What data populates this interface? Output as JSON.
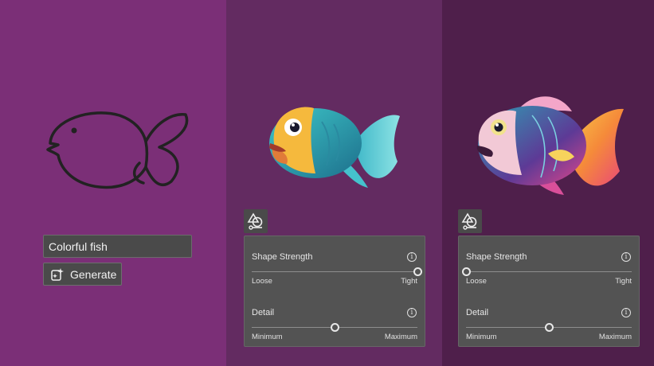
{
  "panels": [
    {
      "name": "sketch",
      "bg": "#7b2f77"
    },
    {
      "name": "result-detailed",
      "bg": "#632b61"
    },
    {
      "name": "result-loose",
      "bg": "#4f1f4b"
    }
  ],
  "prompt": {
    "value": "Colorful fish",
    "placeholder": ""
  },
  "generate": {
    "label": "Generate",
    "icon": "generate-sparkle-icon"
  },
  "reference_icon": "shape-reference-icon",
  "settings": [
    {
      "shape_strength": {
        "label": "Shape Strength",
        "min_label": "Loose",
        "max_label": "Tight",
        "value": 1.0
      },
      "detail": {
        "label": "Detail",
        "min_label": "Minimum",
        "max_label": "Maximum",
        "value": 0.5
      }
    },
    {
      "shape_strength": {
        "label": "Shape Strength",
        "min_label": "Loose",
        "max_label": "Tight",
        "value": 0.0
      },
      "detail": {
        "label": "Detail",
        "min_label": "Minimum",
        "max_label": "Maximum",
        "value": 0.5
      }
    }
  ]
}
